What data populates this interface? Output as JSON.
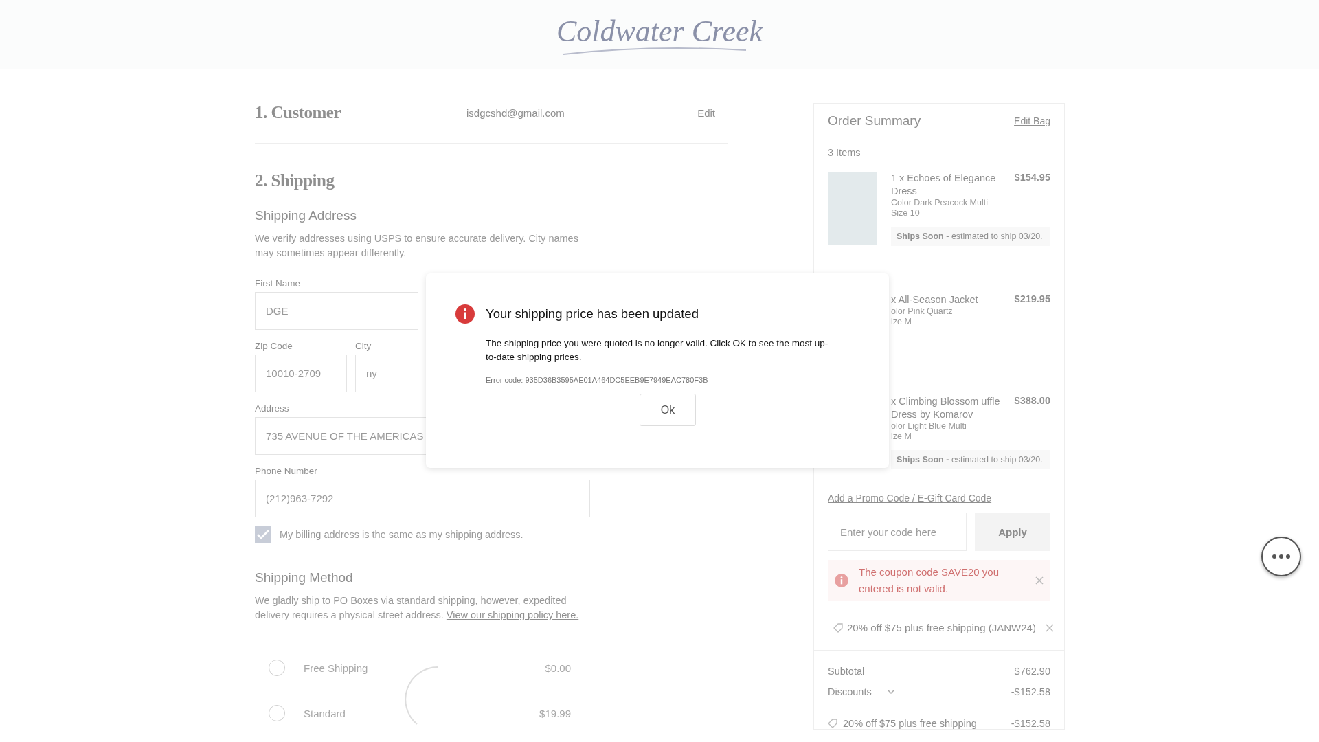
{
  "header": {
    "logo": "Coldwater Creek"
  },
  "customer": {
    "heading": "1. Customer",
    "email": "isdgcshd@gmail.com",
    "edit": "Edit"
  },
  "shipping": {
    "heading": "2. Shipping",
    "address_heading": "Shipping Address",
    "note": "We verify addresses using USPS to ensure accurate delivery. City names may sometimes appear differently.",
    "fields": [
      {
        "label": "First Name",
        "value": "DGE"
      },
      {
        "label": "Zip Code",
        "value": "10010-2709"
      },
      {
        "label": "City",
        "value": "ny"
      },
      {
        "label": "Address",
        "value": "735 AVENUE OF THE AMERICAS"
      },
      {
        "label": "Phone Number",
        "value": "(212)963-7292"
      }
    ],
    "billing_same": {
      "label": "My billing address is the same as my shipping address.",
      "checked": true
    },
    "method_heading": "Shipping Method",
    "method_note": "We gladly ship to PO Boxes via standard shipping, however, expedited delivery requires a physical street address.",
    "policy_link": "View our shipping policy here.",
    "options": [
      {
        "name": "Free Shipping",
        "price": "$0.00",
        "selected": false
      },
      {
        "name": "Standard",
        "price": "$19.99",
        "selected": false
      }
    ]
  },
  "summary": {
    "title": "Order Summary",
    "edit_bag": "Edit Bag",
    "count": "3 Items",
    "items": [
      {
        "photo": true,
        "name": "1 x Echoes of Elegance Dress",
        "variant": "Color Dark Peacock Multi",
        "size": "Size 10",
        "price": "$154.95",
        "ships_label": "Ships Soon -",
        "ships_text": "estimated to ship 03/20."
      },
      {
        "photo": false,
        "name": "x All-Season Jacket",
        "variant": "olor Pink Quartz",
        "size": "ize M",
        "price": "$219.95"
      },
      {
        "photo": false,
        "name": "x Climbing Blossom uffle Dress by Komarov",
        "variant": "olor Light Blue Multi",
        "size": "ize M",
        "price": "$388.00",
        "ships_label": "Ships Soon -",
        "ships_text": "estimated to ship 03/20."
      }
    ],
    "promo_link": "Add a Promo Code / E-Gift Card Code",
    "promo_placeholder": "Enter your code here",
    "apply": "Apply",
    "error": "The coupon code SAVE20 you entered is not valid.",
    "applied_coupon": "20% off $75 plus free shipping (JANW24)",
    "totals": [
      {
        "label": "Subtotal",
        "value": "$762.90",
        "kind": "plain"
      },
      {
        "label": "Discounts",
        "value": "-$152.58",
        "kind": "expandable",
        "expanded": true
      },
      {
        "label": "20% off $75 plus free shipping",
        "value": "-$152.58",
        "kind": "coupon"
      }
    ]
  },
  "dialog": {
    "title": "Your shipping price has been updated",
    "message": "The shipping price you were quoted is no longer valid. Click OK to see the most up-to-date shipping prices.",
    "error_code": "Error code: 935D36B3595AE01A464DC5EEB9E7949EAC780F3B",
    "ok": "Ok"
  }
}
